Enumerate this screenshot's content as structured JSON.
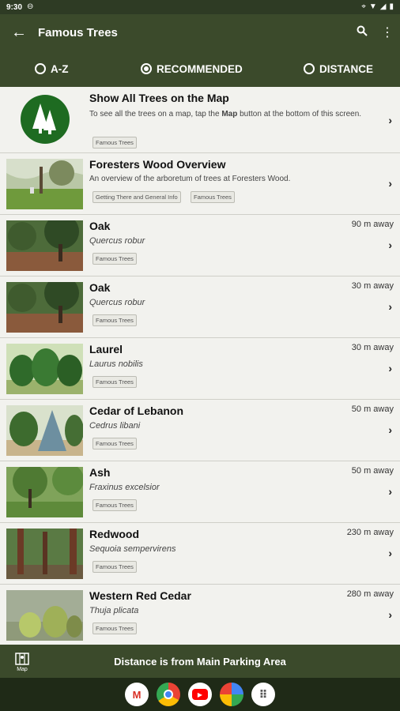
{
  "status_bar": {
    "time": "9:30"
  },
  "app_bar": {
    "back_icon": "arrow-left-icon",
    "title": "Famous Trees",
    "search_icon": "search-icon",
    "menu_icon": "more-vert-icon"
  },
  "sort": {
    "options": [
      "A-Z",
      "RECOMMENDED",
      "DISTANCE"
    ],
    "selected": "RECOMMENDED"
  },
  "rows": [
    {
      "title": "Show All Trees on the Map",
      "desc_pre": "To see all the trees on a map, tap the ",
      "desc_bold": "Map",
      "desc_post": " button at the bottom of this screen.",
      "tags": [
        "Famous Trees"
      ]
    },
    {
      "title": "Foresters Wood Overview",
      "desc": "An overview of the arboretum of trees at Foresters Wood.",
      "tags": [
        "Getting There and General Info",
        "Famous Trees"
      ]
    },
    {
      "title": "Oak",
      "sub": "Quercus robur",
      "distance": "90 m away",
      "tags": [
        "Famous Trees"
      ]
    },
    {
      "title": "Oak",
      "sub": "Quercus robur",
      "distance": "30 m away",
      "tags": [
        "Famous Trees"
      ]
    },
    {
      "title": "Laurel",
      "sub": "Laurus nobilis",
      "distance": "30 m away",
      "tags": [
        "Famous Trees"
      ]
    },
    {
      "title": "Cedar of Lebanon",
      "sub": "Cedrus libani",
      "distance": "50 m away",
      "tags": [
        "Famous Trees"
      ]
    },
    {
      "title": "Ash",
      "sub": "Fraxinus excelsior",
      "distance": "50 m away",
      "tags": [
        "Famous Trees"
      ]
    },
    {
      "title": "Redwood",
      "sub": "Sequoia sempervirens",
      "distance": "230 m away",
      "tags": [
        "Famous Trees"
      ]
    },
    {
      "title": "Western Red Cedar",
      "sub": "Thuja plicata",
      "distance": "280 m away",
      "tags": [
        "Famous Trees"
      ]
    }
  ],
  "bottom_bar": {
    "map_label": "Map",
    "text": "Distance is from Main Parking Area"
  },
  "nav_bar": {
    "apps": [
      "gmail-icon",
      "chrome-icon",
      "youtube-icon",
      "photos-icon",
      "app-drawer-icon"
    ]
  },
  "colors": {
    "primary": "#3b4a2b",
    "dark": "#2e3b24",
    "background": "#f2f2ee"
  }
}
